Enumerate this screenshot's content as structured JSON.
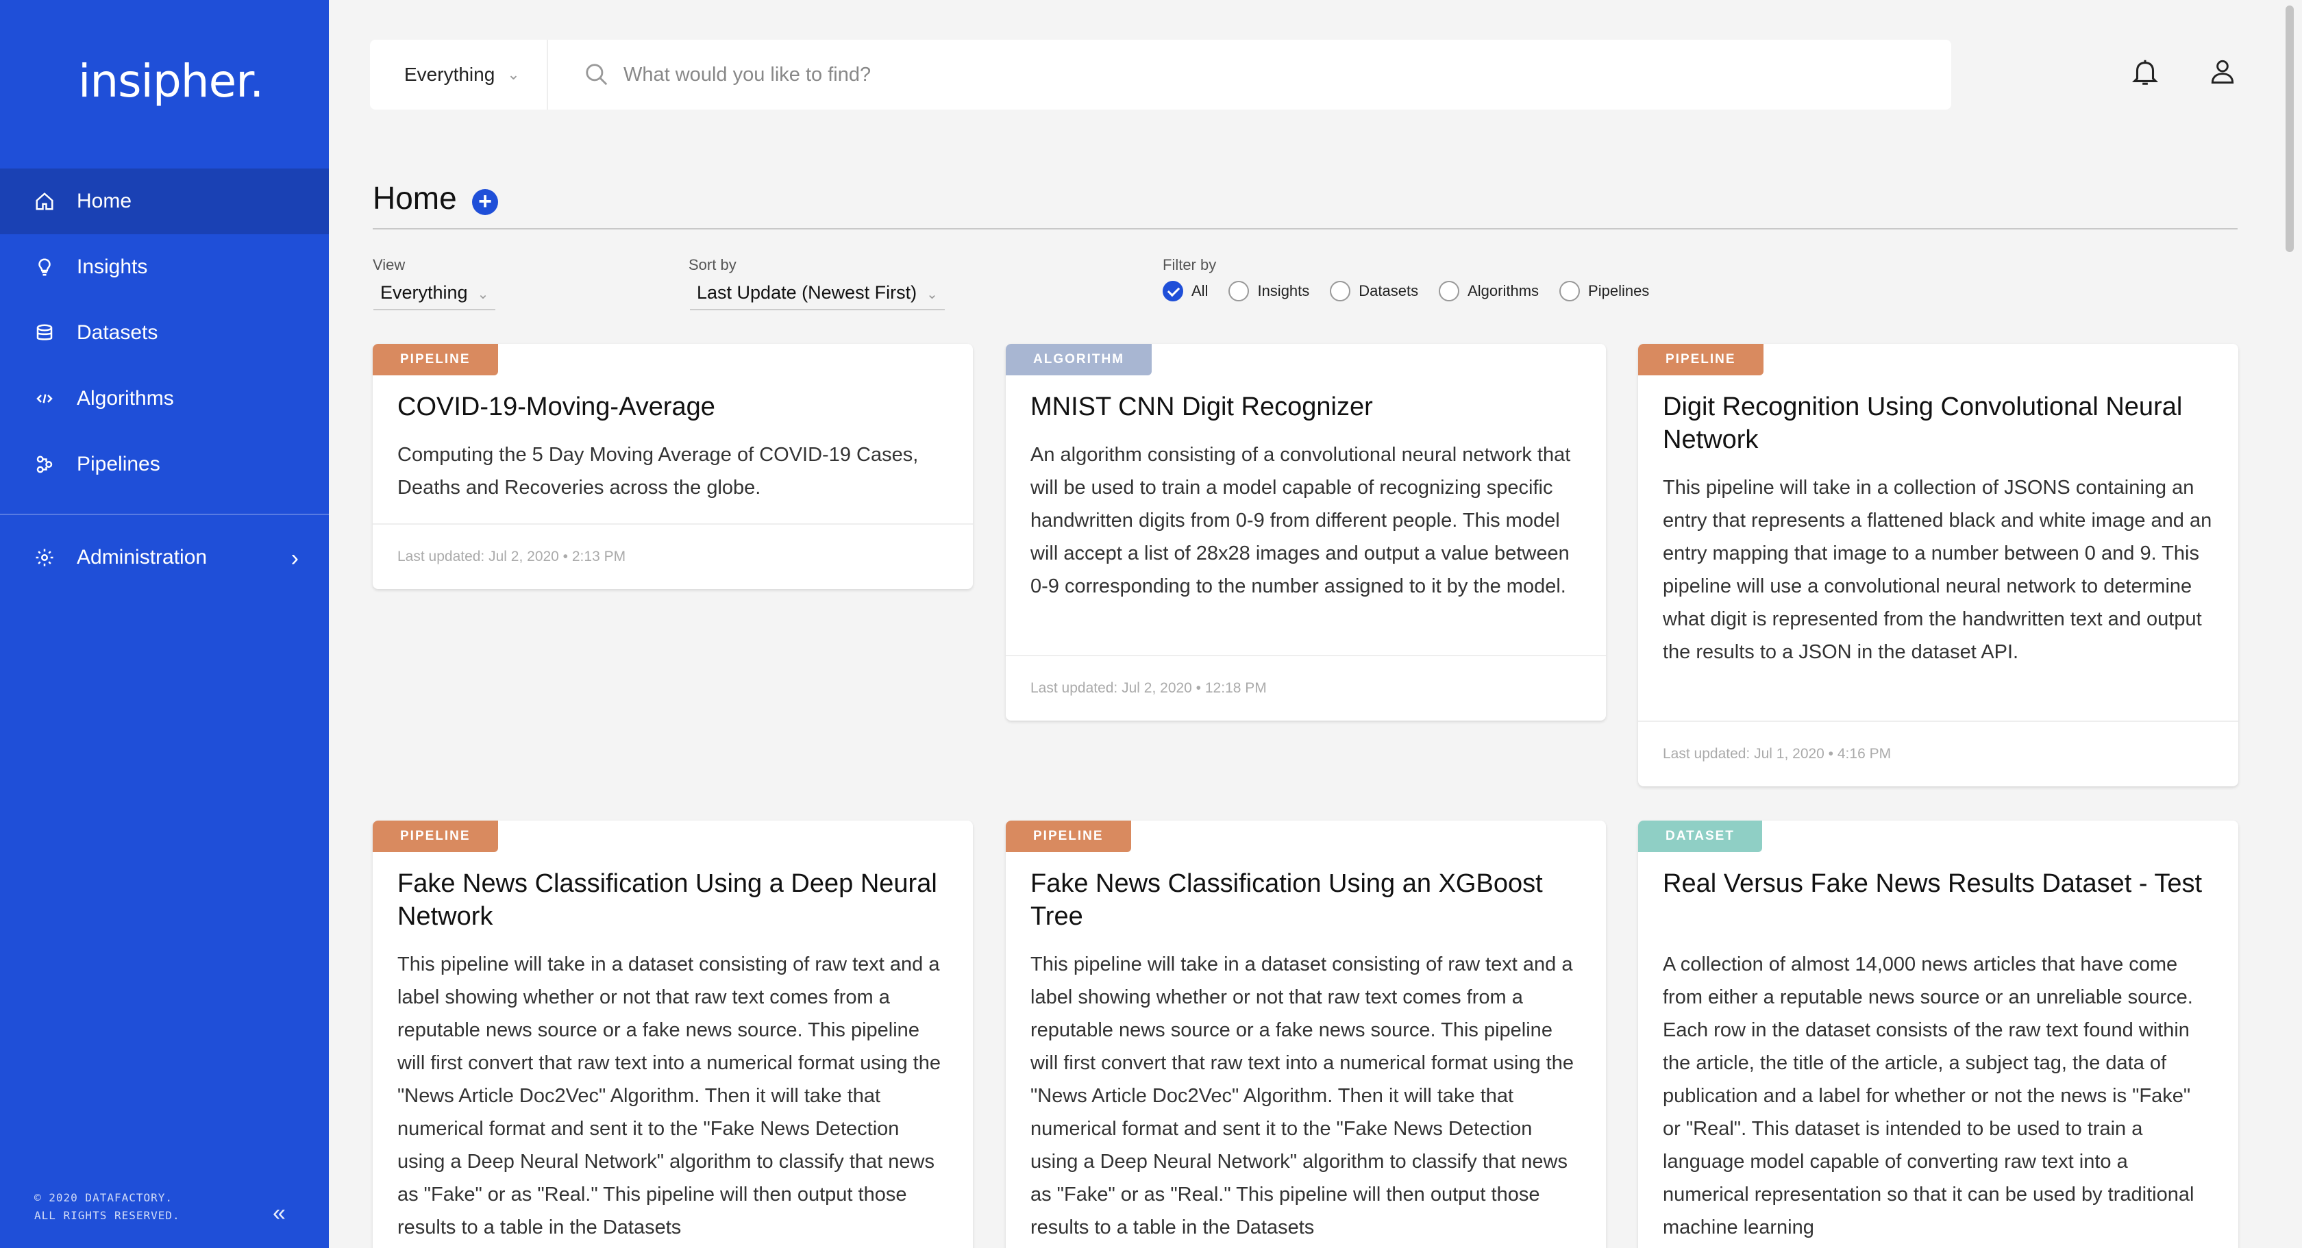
{
  "brand": {
    "logo_text": "insipher."
  },
  "sidebar": {
    "items": [
      {
        "label": "Home",
        "icon": "home-icon",
        "active": true
      },
      {
        "label": "Insights",
        "icon": "lightbulb-icon",
        "active": false
      },
      {
        "label": "Datasets",
        "icon": "database-icon",
        "active": false
      },
      {
        "label": "Algorithms",
        "icon": "code-icon",
        "active": false
      },
      {
        "label": "Pipelines",
        "icon": "pipeline-icon",
        "active": false
      }
    ],
    "admin": {
      "label": "Administration",
      "icon": "gear-icon",
      "chevron": "›"
    },
    "copyright_line1": "© 2020 DATAFACTORY.",
    "copyright_line2": "ALL RIGHTS RESERVED.",
    "collapse_glyph": "«"
  },
  "search": {
    "scope_value": "Everything",
    "placeholder": "What would you like to find?"
  },
  "page": {
    "title": "Home",
    "view_label": "View",
    "view_value": "Everything",
    "sort_label": "Sort by",
    "sort_value": "Last Update (Newest First)",
    "filter_label": "Filter by",
    "filters": [
      {
        "label": "All",
        "checked": true
      },
      {
        "label": "Insights",
        "checked": false
      },
      {
        "label": "Datasets",
        "checked": false
      },
      {
        "label": "Algorithms",
        "checked": false
      },
      {
        "label": "Pipelines",
        "checked": false
      }
    ]
  },
  "cards": [
    {
      "tag": "PIPELINE",
      "title": "COVID-19-Moving-Average",
      "description": "Computing the 5 Day Moving Average of COVID-19 Cases, Deaths and Recoveries across the globe.",
      "updated": "Last updated: Jul 2, 2020 • 2:13 PM"
    },
    {
      "tag": "ALGORITHM",
      "title": "MNIST CNN Digit Recognizer",
      "description": "An algorithm consisting of a convolutional neural network that will be used to train a model capable of recognizing specific handwritten digits from 0-9 from different people. This model will accept a list of 28x28 images and output a value between 0-9 corresponding to the number assigned to it by the model.",
      "updated": "Last updated: Jul 2, 2020 • 12:18 PM"
    },
    {
      "tag": "PIPELINE",
      "title": "Digit Recognition Using Convolutional Neural Network",
      "description": "This pipeline will take in a collection of JSONS containing an entry that represents a flattened black and white image and an entry mapping that image to a number between 0 and 9. This pipeline will use a convolutional neural network to determine what digit is represented from the handwritten text and output the results to a JSON in the dataset API.",
      "updated": "Last updated: Jul 1, 2020 • 4:16 PM"
    },
    {
      "tag": "PIPELINE",
      "title": "Fake News Classification Using a Deep Neural Network",
      "description": "This pipeline will take in a dataset consisting of raw text and a label showing whether or not that raw text comes from a reputable news source or a fake news source. This pipeline will first convert that raw text into a numerical format using the \"News Article Doc2Vec\" Algorithm. Then it will take that numerical format and sent it to the \"Fake News Detection using a Deep Neural Network\" algorithm to classify that news as \"Fake\" or as \"Real.\" This pipeline will then output those results to a table in the Datasets"
    },
    {
      "tag": "PIPELINE",
      "title": "Fake News Classification Using an XGBoost Tree",
      "description": "This pipeline will take in a dataset consisting of raw text and a label showing whether or not that raw text comes from a reputable news source or a fake news source. This pipeline will first convert that raw text into a numerical format using the \"News Article Doc2Vec\" Algorithm. Then it will take that numerical format and sent it to the \"Fake News Detection using a Deep Neural Network\" algorithm to classify that news as \"Fake\" or as \"Real.\" This pipeline will then output those results to a table in the Datasets"
    },
    {
      "tag": "DATASET",
      "title": "Real Versus Fake News Results Dataset - Test",
      "description": "A collection of almost 14,000 news articles that have come from either a reputable news source or an unreliable source. Each row in the dataset consists of the raw text found within the article, the title of the article, a subject tag, the data of publication and a label for whether or not the news is \"Fake\" or \"Real\". This dataset is intended to be used to train a language model capable of converting raw text into a numerical representation so that it can be used by traditional machine learning"
    }
  ]
}
